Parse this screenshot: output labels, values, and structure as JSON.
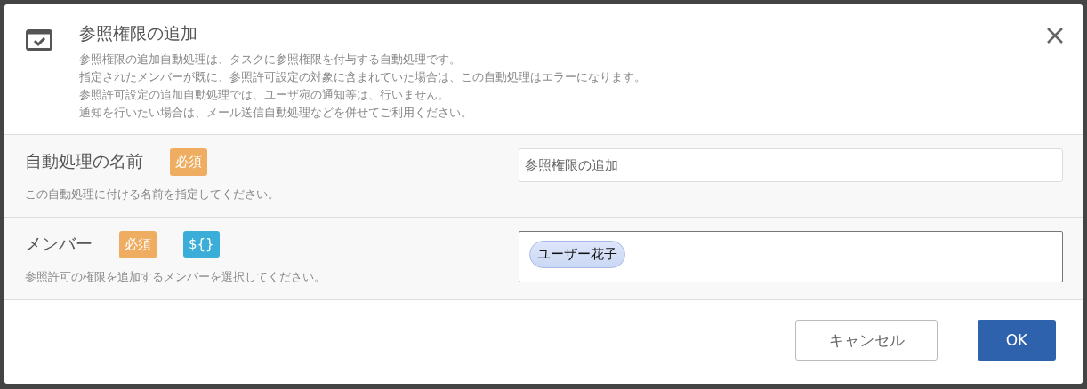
{
  "dialog": {
    "title": "参照権限の追加",
    "description": [
      "参照権限の追加自動処理は、タスクに参照権限を付与する自動処理です。",
      "指定されたメンバーが既に、参照許可設定の対象に含まれていた場合は、この自動処理はエラーになります。",
      "参照許可設定の追加自動処理では、ユーザ宛の通知等は、行いません。",
      "通知を行いたい場合は、メール送信自動処理などを併せてご利用ください。"
    ]
  },
  "fields": [
    {
      "label": "自動処理の名前",
      "hint": "この自動処理に付ける名前を指定してください。",
      "kind": "text",
      "badges": [
        {
          "kind": "required",
          "text": "必須"
        }
      ],
      "value": "参照権限の追加"
    },
    {
      "label": "メンバー",
      "hint": "参照許可の権限を追加するメンバーを選択してください。",
      "kind": "tokens",
      "badges": [
        {
          "kind": "required",
          "text": "必須"
        },
        {
          "kind": "variable",
          "text": "${}"
        }
      ],
      "tokens": [
        "ユーザー花子"
      ]
    }
  ],
  "buttons": [
    {
      "kind": "secondary",
      "label": "キャンセル"
    },
    {
      "kind": "primary",
      "label": "OK"
    }
  ]
}
